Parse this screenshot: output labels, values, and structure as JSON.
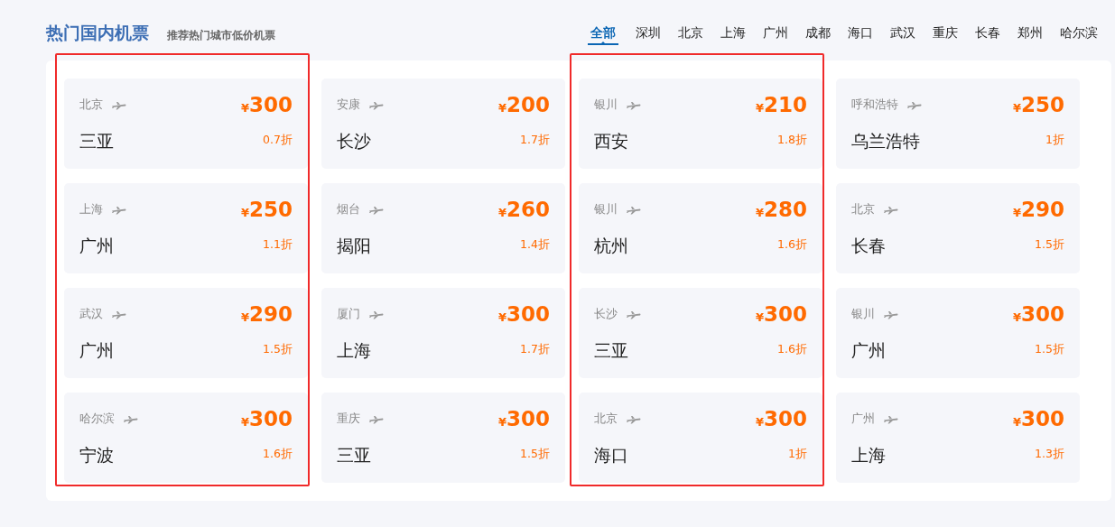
{
  "header": {
    "title": "热门国内机票",
    "subtitle": "推荐热门城市低价机票"
  },
  "tabs": [
    {
      "label": "全部",
      "selected": true
    },
    {
      "label": "深圳",
      "selected": false
    },
    {
      "label": "北京",
      "selected": false
    },
    {
      "label": "上海",
      "selected": false
    },
    {
      "label": "广州",
      "selected": false
    },
    {
      "label": "成都",
      "selected": false
    },
    {
      "label": "海口",
      "selected": false
    },
    {
      "label": "武汉",
      "selected": false
    },
    {
      "label": "重庆",
      "selected": false
    },
    {
      "label": "长春",
      "selected": false
    },
    {
      "label": "郑州",
      "selected": false
    },
    {
      "label": "哈尔滨",
      "selected": false
    }
  ],
  "columns": [
    {
      "highlighted": true,
      "cards": [
        {
          "origin": "北京",
          "currency": "¥",
          "price": "300",
          "destination": "三亚",
          "discount": "0.7折"
        },
        {
          "origin": "上海",
          "currency": "¥",
          "price": "250",
          "destination": "广州",
          "discount": "1.1折"
        },
        {
          "origin": "武汉",
          "currency": "¥",
          "price": "290",
          "destination": "广州",
          "discount": "1.5折"
        },
        {
          "origin": "哈尔滨",
          "currency": "¥",
          "price": "300",
          "destination": "宁波",
          "discount": "1.6折"
        }
      ]
    },
    {
      "highlighted": false,
      "cards": [
        {
          "origin": "安康",
          "currency": "¥",
          "price": "200",
          "destination": "长沙",
          "discount": "1.7折"
        },
        {
          "origin": "烟台",
          "currency": "¥",
          "price": "260",
          "destination": "揭阳",
          "discount": "1.4折"
        },
        {
          "origin": "厦门",
          "currency": "¥",
          "price": "300",
          "destination": "上海",
          "discount": "1.7折"
        },
        {
          "origin": "重庆",
          "currency": "¥",
          "price": "300",
          "destination": "三亚",
          "discount": "1.5折"
        }
      ]
    },
    {
      "highlighted": true,
      "cards": [
        {
          "origin": "银川",
          "currency": "¥",
          "price": "210",
          "destination": "西安",
          "discount": "1.8折"
        },
        {
          "origin": "银川",
          "currency": "¥",
          "price": "280",
          "destination": "杭州",
          "discount": "1.6折"
        },
        {
          "origin": "长沙",
          "currency": "¥",
          "price": "300",
          "destination": "三亚",
          "discount": "1.6折"
        },
        {
          "origin": "北京",
          "currency": "¥",
          "price": "300",
          "destination": "海口",
          "discount": "1折"
        }
      ]
    },
    {
      "highlighted": false,
      "cards": [
        {
          "origin": "呼和浩特",
          "currency": "¥",
          "price": "250",
          "destination": "乌兰浩特",
          "discount": "1折"
        },
        {
          "origin": "北京",
          "currency": "¥",
          "price": "290",
          "destination": "长春",
          "discount": "1.5折"
        },
        {
          "origin": "银川",
          "currency": "¥",
          "price": "300",
          "destination": "广州",
          "discount": "1.5折"
        },
        {
          "origin": "广州",
          "currency": "¥",
          "price": "300",
          "destination": "上海",
          "discount": "1.3折"
        }
      ]
    }
  ]
}
